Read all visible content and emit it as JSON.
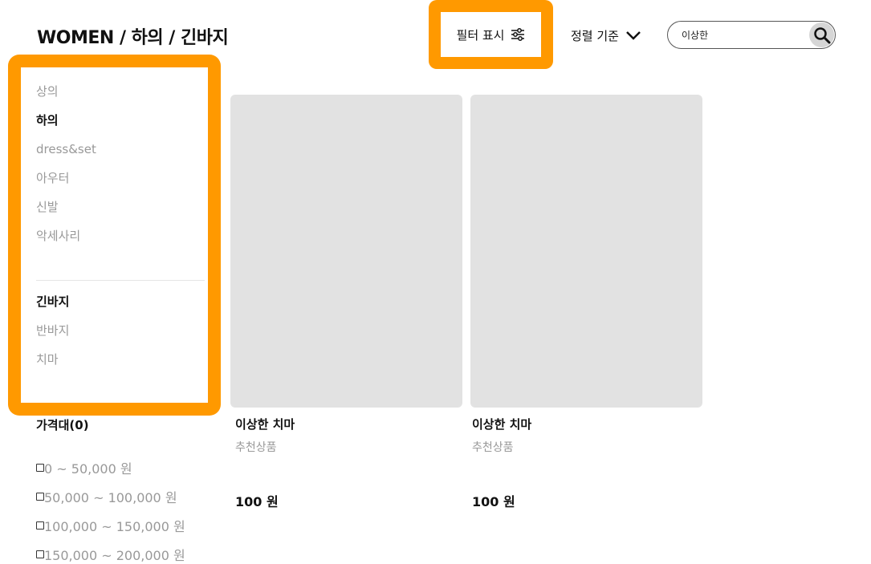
{
  "header": {
    "breadcrumb": "WOMEN / 하의 / 긴바지",
    "filter_label": "필터 표시",
    "sort_label": "정렬 기준",
    "search_value": "이상한",
    "accent_color": "#ff9900"
  },
  "sidebar": {
    "categories": [
      {
        "label": "상의",
        "active": false
      },
      {
        "label": "하의",
        "active": true
      },
      {
        "label": "dress&set",
        "active": false
      },
      {
        "label": "아우터",
        "active": false
      },
      {
        "label": "신발",
        "active": false
      },
      {
        "label": "악세사리",
        "active": false
      }
    ],
    "subcategories": [
      {
        "label": "긴바지",
        "active": true
      },
      {
        "label": "반바지",
        "active": false
      },
      {
        "label": "치마",
        "active": false
      }
    ]
  },
  "price_filter": {
    "title": "가격대(0)",
    "options": [
      "0 ~ 50,000 원",
      "50,000 ~ 100,000 원",
      "100,000 ~ 150,000 원",
      "150,000 ~ 200,000 원"
    ]
  },
  "products": [
    {
      "name": "이상한 치마",
      "tag": "추천상품",
      "price": "100 원"
    },
    {
      "name": "이상한 치마",
      "tag": "추천상품",
      "price": "100 원"
    }
  ]
}
